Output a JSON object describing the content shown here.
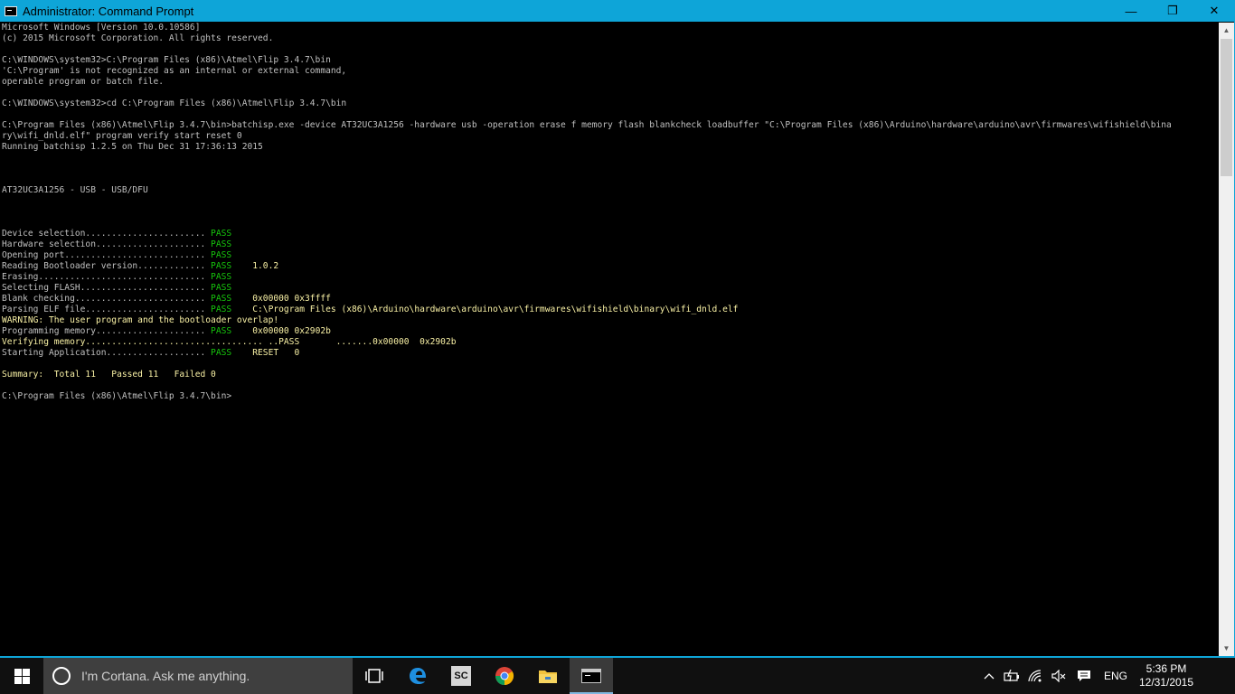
{
  "window": {
    "title": "Administrator: Command Prompt",
    "controls": {
      "minimize": "—",
      "restore": "❐",
      "close": "✕"
    }
  },
  "console": {
    "lines": [
      [
        {
          "t": "Microsoft Windows [Version 10.0.10586]"
        }
      ],
      [
        {
          "t": "(c) 2015 Microsoft Corporation. All rights reserved."
        }
      ],
      [
        {
          "t": ""
        }
      ],
      [
        {
          "t": "C:\\WINDOWS\\system32>C:\\Program Files (x86)\\Atmel\\Flip 3.4.7\\bin"
        }
      ],
      [
        {
          "t": "'C:\\Program' is not recognized as an internal or external command,"
        }
      ],
      [
        {
          "t": "operable program or batch file."
        }
      ],
      [
        {
          "t": ""
        }
      ],
      [
        {
          "t": "C:\\WINDOWS\\system32>cd C:\\Program Files (x86)\\Atmel\\Flip 3.4.7\\bin"
        }
      ],
      [
        {
          "t": ""
        }
      ],
      [
        {
          "t": "C:\\Program Files (x86)\\Atmel\\Flip 3.4.7\\bin>batchisp.exe -device AT32UC3A1256 -hardware usb -operation erase f memory flash blankcheck loadbuffer \"C:\\Program Files (x86)\\Arduino\\hardware\\arduino\\avr\\firmwares\\wifishield\\bina"
        }
      ],
      [
        {
          "t": "ry\\wifi_dnld.elf\" program verify start reset 0"
        }
      ],
      [
        {
          "t": "Running batchisp 1.2.5 on Thu Dec 31 17:36:13 2015"
        }
      ],
      [
        {
          "t": ""
        }
      ],
      [
        {
          "t": ""
        }
      ],
      [
        {
          "t": ""
        }
      ],
      [
        {
          "t": "AT32UC3A1256 - USB - USB/DFU"
        }
      ],
      [
        {
          "t": ""
        }
      ],
      [
        {
          "t": ""
        }
      ],
      [
        {
          "t": ""
        }
      ],
      [
        {
          "t": "Device selection....................... "
        },
        {
          "t": "PASS",
          "c": "g"
        }
      ],
      [
        {
          "t": "Hardware selection..................... "
        },
        {
          "t": "PASS",
          "c": "g"
        }
      ],
      [
        {
          "t": "Opening port........................... "
        },
        {
          "t": "PASS",
          "c": "g"
        }
      ],
      [
        {
          "t": "Reading Bootloader version............. "
        },
        {
          "t": "PASS",
          "c": "g"
        },
        {
          "t": "    1.0.2",
          "c": "y"
        }
      ],
      [
        {
          "t": "Erasing................................ "
        },
        {
          "t": "PASS",
          "c": "g"
        }
      ],
      [
        {
          "t": "Selecting FLASH........................ "
        },
        {
          "t": "PASS",
          "c": "g"
        }
      ],
      [
        {
          "t": "Blank checking......................... "
        },
        {
          "t": "PASS",
          "c": "g"
        },
        {
          "t": "    0x00000 0x3ffff",
          "c": "y"
        }
      ],
      [
        {
          "t": "Parsing ELF file....................... "
        },
        {
          "t": "PASS",
          "c": "g"
        },
        {
          "t": "    C:\\Program Files (x86)\\Arduino\\hardware\\arduino\\avr\\firmwares\\wifishield\\binary\\wifi_dnld.elf",
          "c": "y"
        }
      ],
      [
        {
          "t": "WARNING: The user program and the bootloader overlap!",
          "c": "y"
        }
      ],
      [
        {
          "t": "Programming memory..................... "
        },
        {
          "t": "PASS",
          "c": "g"
        },
        {
          "t": "    0x00000 0x2902b",
          "c": "y"
        }
      ],
      [
        {
          "t": "Verifying memory.................................. ..PASS       .......0x00000  0x2902b",
          "c": "y"
        }
      ],
      [
        {
          "t": "Starting Application................... "
        },
        {
          "t": "PASS",
          "c": "g"
        },
        {
          "t": "    RESET   0",
          "c": "y"
        }
      ],
      [
        {
          "t": ""
        }
      ],
      [
        {
          "t": "Summary:  Total 11   Passed 11   Failed 0",
          "c": "y"
        }
      ],
      [
        {
          "t": ""
        }
      ],
      [
        {
          "t": "C:\\Program Files (x86)\\Atmel\\Flip 3.4.7\\bin>"
        }
      ]
    ]
  },
  "taskbar": {
    "cortana_placeholder": "I'm Cortana. Ask me anything.",
    "apps": [
      {
        "name": "task-view-icon"
      },
      {
        "name": "edge-icon"
      },
      {
        "name": "sc-app-icon",
        "label": "SC"
      },
      {
        "name": "chrome-icon"
      },
      {
        "name": "file-explorer-icon"
      },
      {
        "name": "command-prompt-icon",
        "active": true
      }
    ],
    "tray": {
      "language": "ENG",
      "time": "5:36 PM",
      "date": "12/31/2015"
    }
  },
  "colors": {
    "title_bar": "#0ea5d8",
    "pass_green": "#16c60c",
    "info_yellow": "#f9f1a5",
    "console_text": "#c0c0c0",
    "taskbar": "#101010",
    "search_box": "#3f3f3f"
  }
}
